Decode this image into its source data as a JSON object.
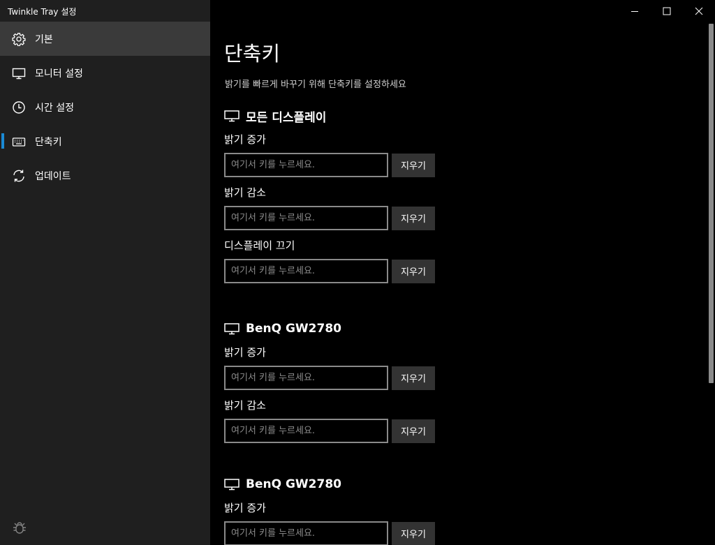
{
  "window": {
    "title": "Twinkle Tray 설정"
  },
  "sidebar": {
    "items": [
      {
        "label": "기본",
        "icon": "gear-icon",
        "active": false
      },
      {
        "label": "모니터 설정",
        "icon": "monitor-icon",
        "active": false
      },
      {
        "label": "시간 설정",
        "icon": "clock-icon",
        "active": false
      },
      {
        "label": "단축키",
        "icon": "keyboard-icon",
        "active": true
      },
      {
        "label": "업데이트",
        "icon": "refresh-icon",
        "active": false
      }
    ],
    "hover_item": 0,
    "accent_color": "#1a8ad4"
  },
  "main": {
    "title": "단축키",
    "description": "밝기를 빠르게 바꾸기 위해 단축키를 설정하세요",
    "input_placeholder": "여기서 키를 누르세요.",
    "clear_label": "지우기",
    "sections": [
      {
        "name": "모든 디스플레이",
        "hotkeys": [
          "밝기 증가",
          "밝기 감소",
          "디스플레이 끄기"
        ]
      },
      {
        "name": "BenQ GW2780",
        "hotkeys": [
          "밝기 증가",
          "밝기 감소"
        ]
      },
      {
        "name": "BenQ GW2780",
        "hotkeys": [
          "밝기 증가"
        ]
      }
    ]
  }
}
